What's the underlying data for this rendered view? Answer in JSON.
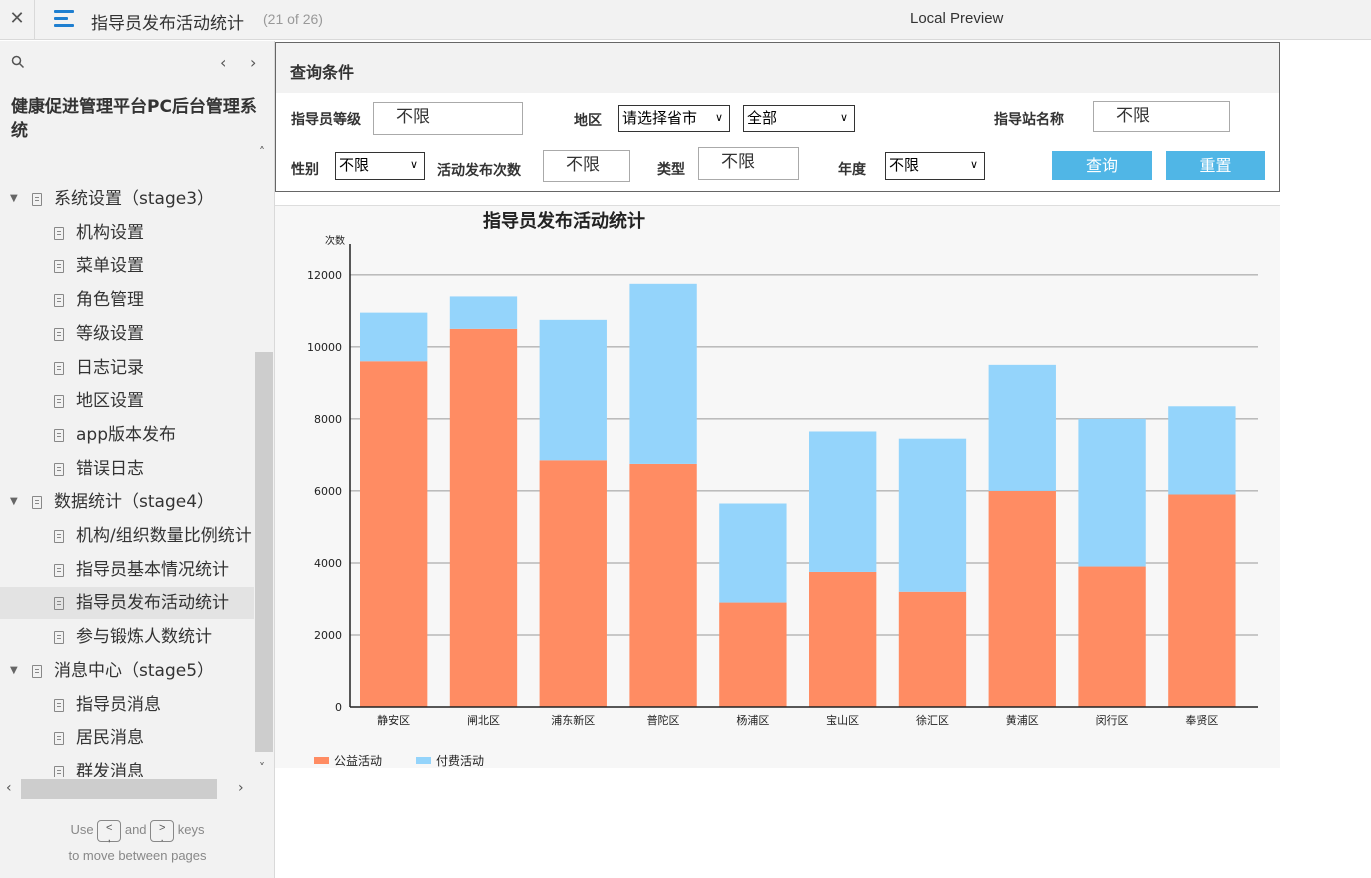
{
  "topbar": {
    "close_glyph": "✕",
    "title": "指导员发布活动统计",
    "page_count": "(21 of 26)",
    "preview_label": "Local Preview"
  },
  "sidebar": {
    "project_name": "健康促进管理平台PC后台管理系统",
    "tree": [
      {
        "level": 1,
        "label": "系统设置（stage3）",
        "expanded": true,
        "selected": false
      },
      {
        "level": 2,
        "label": "机构设置",
        "selected": false
      },
      {
        "level": 2,
        "label": "菜单设置",
        "selected": false
      },
      {
        "level": 2,
        "label": "角色管理",
        "selected": false
      },
      {
        "level": 2,
        "label": "等级设置",
        "selected": false
      },
      {
        "level": 2,
        "label": "日志记录",
        "selected": false
      },
      {
        "level": 2,
        "label": "地区设置",
        "selected": false
      },
      {
        "level": 2,
        "label": "app版本发布",
        "selected": false
      },
      {
        "level": 2,
        "label": "错误日志",
        "selected": false
      },
      {
        "level": 1,
        "label": "数据统计（stage4）",
        "expanded": true,
        "selected": false
      },
      {
        "level": 2,
        "label": "机构/组织数量比例统计",
        "selected": false
      },
      {
        "level": 2,
        "label": "指导员基本情况统计",
        "selected": false
      },
      {
        "level": 2,
        "label": "指导员发布活动统计",
        "selected": true
      },
      {
        "level": 2,
        "label": "参与锻炼人数统计",
        "selected": false
      },
      {
        "level": 1,
        "label": "消息中心（stage5）",
        "expanded": true,
        "selected": false
      },
      {
        "level": 2,
        "label": "指导员消息",
        "selected": false
      },
      {
        "level": 2,
        "label": "居民消息",
        "selected": false
      },
      {
        "level": 2,
        "label": "群发消息",
        "selected": false
      }
    ],
    "hint_use": "Use",
    "hint_and": "and",
    "hint_keys": "keys",
    "hint_line2": "to move between pages",
    "key_prev": "<",
    "key_prev_sub": ",",
    "key_next": ">",
    "key_next_sub": "."
  },
  "query": {
    "title": "查询条件",
    "level_label": "指导员等级",
    "level_value": "不限",
    "region_label": "地区",
    "province_select": "请选择省市",
    "district_select": "全部",
    "station_label": "指导站名称",
    "station_value": "不限",
    "gender_label": "性别",
    "gender_select": "不限",
    "count_label": "活动发布次数",
    "count_value": "不限",
    "type_label": "类型",
    "type_value": "不限",
    "year_label": "年度",
    "year_select": "不限",
    "search_button": "查询",
    "reset_button": "重置"
  },
  "colors": {
    "series1": "#ff8c63",
    "series2": "#94d4fb",
    "button": "#50b6e6",
    "menu_icon": "#1f7fd0"
  },
  "chart_data": {
    "type": "bar",
    "stacked": true,
    "title": "指导员发布活动统计",
    "ylabel": "次数",
    "xlabel": "",
    "categories": [
      "静安区",
      "闸北区",
      "浦东新区",
      "普陀区",
      "杨浦区",
      "宝山区",
      "徐汇区",
      "黄浦区",
      "闵行区",
      "奉贤区"
    ],
    "series": [
      {
        "name": "公益活动",
        "color": "#ff8c63",
        "values": [
          9600,
          10500,
          6850,
          6750,
          2900,
          3750,
          3200,
          6000,
          3900,
          5900
        ]
      },
      {
        "name": "付费活动",
        "color": "#94d4fb",
        "values": [
          1350,
          900,
          3900,
          5000,
          2750,
          3900,
          4250,
          3500,
          4100,
          2450
        ]
      }
    ],
    "ylim": [
      0,
      12800
    ],
    "yticks": [
      0,
      2000,
      4000,
      6000,
      8000,
      10000,
      12000
    ],
    "grid": true,
    "legend": "bottom-left"
  }
}
